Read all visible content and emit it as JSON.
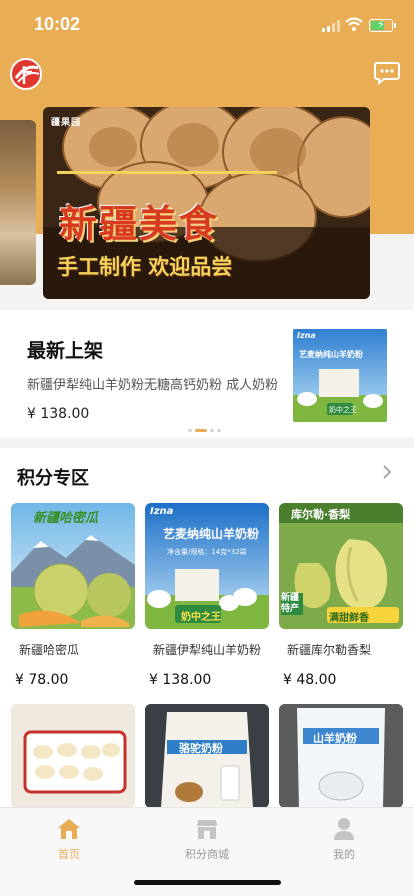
{
  "status_bar": {
    "time": "10:02"
  },
  "header": {
    "logo_icon": "brand-logo-icon",
    "message_icon": "message-icon"
  },
  "banner": {
    "logo_text": "疆果园",
    "title": "新疆美食",
    "subtitle": "手工制作 欢迎品尝"
  },
  "newest": {
    "title": "最新上架",
    "product_name": "新疆伊犁纯山羊奶粉无糖高钙奶粉 成人奶粉",
    "price": "¥ 138.00",
    "image_brand": "Izna",
    "image_title": "艺麦纳纯山羊奶粉",
    "image_tag": "奶中之王"
  },
  "points_zone": {
    "title": "积分专区",
    "products": [
      {
        "name": "新疆哈密瓜",
        "price": "¥ 78.00",
        "img_text": "新疆哈密瓜"
      },
      {
        "name": "新疆伊犁纯山羊奶粉",
        "price": "¥ 138.00",
        "img_text": "艺麦纳纯山羊奶粉",
        "img_brand": "Izna",
        "img_tag": "奶中之王",
        "img_spec": "净含量/规格：14克*32袋"
      },
      {
        "name": "新疆库尔勒香梨",
        "price": "¥ 48.00",
        "img_text": "库尔勒·香梨",
        "img_tag1": "新疆特产",
        "img_tag2": "满甜鲜香"
      }
    ],
    "row2": [
      {
        "img_text": ""
      },
      {
        "img_text": "骆驼奶粉"
      },
      {
        "img_text": "山羊奶粉"
      }
    ]
  },
  "tabbar": {
    "items": [
      {
        "label": "首页",
        "icon": "home-icon",
        "active": true
      },
      {
        "label": "积分商城",
        "icon": "store-icon",
        "active": false
      },
      {
        "label": "我的",
        "icon": "user-icon",
        "active": false
      }
    ]
  },
  "colors": {
    "accent": "#e9ad56",
    "background": "#f3f3f3"
  }
}
